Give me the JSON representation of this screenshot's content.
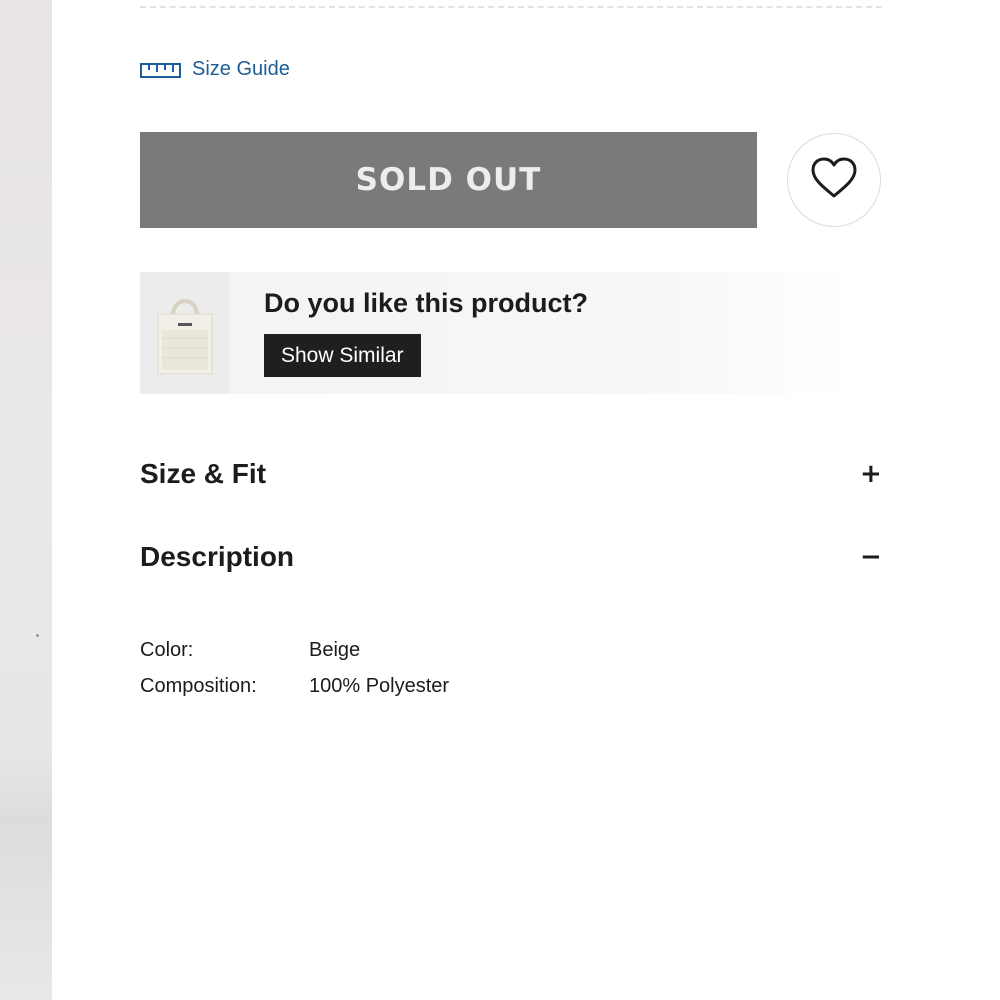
{
  "size_guide": {
    "label": "Size Guide",
    "icon": "ruler-icon",
    "color": "#1f5d99"
  },
  "purchase": {
    "sold_out_label": "SOLD OUT",
    "sold_out_bg": "#7a7a7a",
    "wishlist_icon": "heart-icon"
  },
  "similar": {
    "title": "Do you like this product?",
    "button_label": "Show Similar",
    "thumbnail": "tote-bag-image"
  },
  "accordions": [
    {
      "title": "Size & Fit",
      "toggle": "+",
      "expanded": false
    },
    {
      "title": "Description",
      "toggle": "−",
      "expanded": true
    }
  ],
  "description": {
    "rows": [
      {
        "key": "Color:",
        "value": "Beige"
      },
      {
        "key": "Composition:",
        "value": "100% Polyester"
      }
    ]
  }
}
